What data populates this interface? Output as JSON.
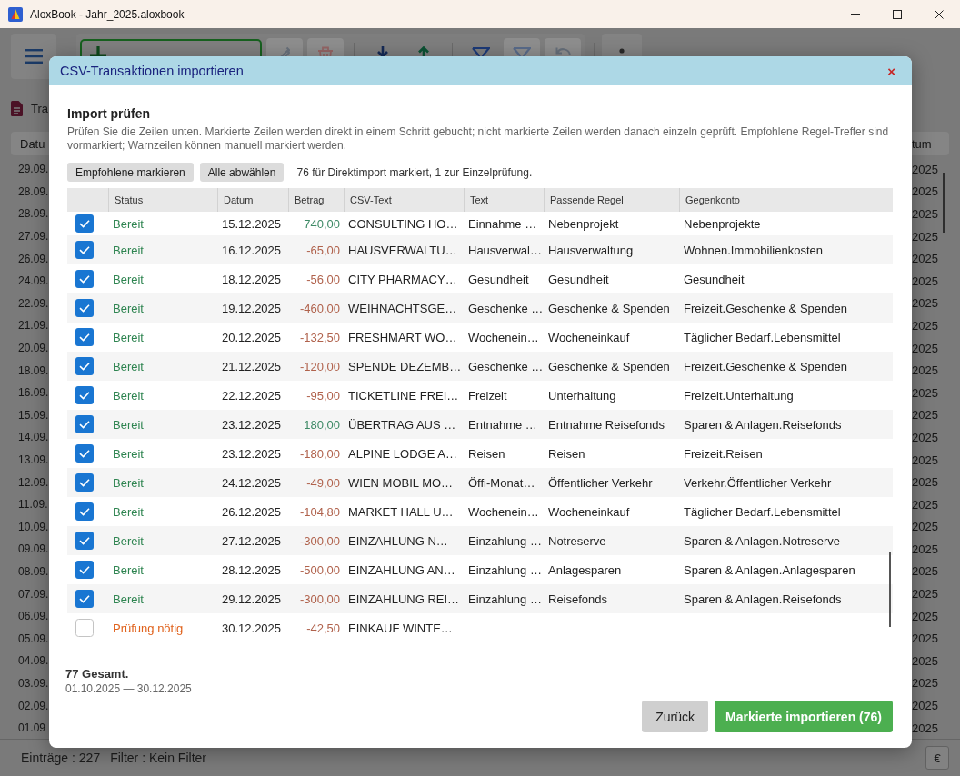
{
  "window": {
    "title": "AloxBook - Jahr_2025.aloxbook"
  },
  "toolbar": {
    "tools": [
      {
        "kind": "edit",
        "disabled": true
      },
      {
        "kind": "delete",
        "disabled": true
      },
      {
        "kind": "import",
        "disabled": false
      },
      {
        "kind": "export",
        "disabled": false
      },
      {
        "kind": "filter",
        "disabled": false
      },
      {
        "kind": "clear-filter",
        "disabled": true
      },
      {
        "kind": "undo",
        "disabled": true
      }
    ]
  },
  "tab": {
    "label": "Tra"
  },
  "background_table": {
    "columns": [
      "Datu",
      "tum"
    ],
    "rows": [
      [
        "29.09.",
        "2025"
      ],
      [
        "28.09.",
        "2025"
      ],
      [
        "28.09.",
        "2025"
      ],
      [
        "27.09.",
        "2025"
      ],
      [
        "26.09.",
        "2025"
      ],
      [
        "24.09.",
        "2025"
      ],
      [
        "22.09.",
        "2025"
      ],
      [
        "21.09.",
        "2025"
      ],
      [
        "20.09.",
        "2025"
      ],
      [
        "18.09.",
        "2025"
      ],
      [
        "16.09.",
        "2025"
      ],
      [
        "15.09.",
        "2025"
      ],
      [
        "14.09.",
        "2025"
      ],
      [
        "13.09.",
        "2025"
      ],
      [
        "12.09.",
        "2025"
      ],
      [
        "11.09.",
        "2025"
      ],
      [
        "10.09.",
        "2025"
      ],
      [
        "09.09.",
        "2025"
      ],
      [
        "08.09.",
        "2025"
      ],
      [
        "07.09.",
        "2025"
      ],
      [
        "06.09.",
        "2025"
      ],
      [
        "05.09.",
        "2025"
      ],
      [
        "04.09.",
        "2025"
      ],
      [
        "03.09.",
        "2025"
      ],
      [
        "02.09.",
        "2025"
      ],
      [
        "01.09",
        "2025"
      ]
    ]
  },
  "dialog": {
    "title": "CSV-Transaktionen importieren",
    "close": "×",
    "heading": "Import prüfen",
    "description": "Prüfen Sie die Zeilen unten. Markierte Zeilen werden direkt in einem Schritt gebucht; nicht markierte Zeilen werden danach einzeln geprüft. Empfohlene Regel-Treffer sind vormarkiert; Warnzeilen können manuell markiert werden.",
    "actions": [
      "Empfohlene markieren",
      "Alle abwählen"
    ],
    "selection_summary": "76 für Direktimport markiert, 1 zur Einzelprüfung.",
    "table": {
      "columns": [
        "Status",
        "Datum",
        "Betrag",
        "CSV-Text",
        "Text",
        "Passende Regel",
        "Gegenkonto"
      ],
      "rows": [
        {
          "checked": true,
          "status": {
            "label": "Bereit",
            "color": "#2e8450"
          },
          "date": "15.12.2025",
          "amount": {
            "value": "740,00",
            "color": "#3e8a66"
          },
          "csv_text": "CONSULTING HO…",
          "text": "Einnahme …",
          "rule": "Nebenprojekt",
          "account": "Nebenprojekte"
        },
        {
          "checked": true,
          "status": {
            "label": "Bereit",
            "color": "#2e8450"
          },
          "date": "16.12.2025",
          "amount": {
            "value": "-65,00",
            "color": "#b0624c"
          },
          "csv_text": "HAUSVERWALTU…",
          "text": "Hausverwal…",
          "rule": "Hausverwaltung",
          "account": "Wohnen.Immobilienkosten"
        },
        {
          "checked": true,
          "status": {
            "label": "Bereit",
            "color": "#2e8450"
          },
          "date": "18.12.2025",
          "amount": {
            "value": "-56,00",
            "color": "#b0624c"
          },
          "csv_text": "CITY PHARMACY…",
          "text": "Gesundheit",
          "rule": "Gesundheit",
          "account": "Gesundheit"
        },
        {
          "checked": true,
          "status": {
            "label": "Bereit",
            "color": "#2e8450"
          },
          "date": "19.12.2025",
          "amount": {
            "value": "-460,00",
            "color": "#b0624c"
          },
          "csv_text": "WEIHNACHTSGE…",
          "text": "Geschenke …",
          "rule": "Geschenke & Spenden",
          "account": "Freizeit.Geschenke & Spenden"
        },
        {
          "checked": true,
          "status": {
            "label": "Bereit",
            "color": "#2e8450"
          },
          "date": "20.12.2025",
          "amount": {
            "value": "-132,50",
            "color": "#b0624c"
          },
          "csv_text": "FRESHMART WO…",
          "text": "Wochenein…",
          "rule": "Wocheneinkauf",
          "account": "Täglicher Bedarf.Lebensmittel"
        },
        {
          "checked": true,
          "status": {
            "label": "Bereit",
            "color": "#2e8450"
          },
          "date": "21.12.2025",
          "amount": {
            "value": "-120,00",
            "color": "#b0624c"
          },
          "csv_text": "SPENDE DEZEMB…",
          "text": "Geschenke …",
          "rule": "Geschenke & Spenden",
          "account": "Freizeit.Geschenke & Spenden"
        },
        {
          "checked": true,
          "status": {
            "label": "Bereit",
            "color": "#2e8450"
          },
          "date": "22.12.2025",
          "amount": {
            "value": "-95,00",
            "color": "#b0624c"
          },
          "csv_text": "TICKETLINE FREI…",
          "text": "Freizeit",
          "rule": "Unterhaltung",
          "account": "Freizeit.Unterhaltung"
        },
        {
          "checked": true,
          "status": {
            "label": "Bereit",
            "color": "#2e8450"
          },
          "date": "23.12.2025",
          "amount": {
            "value": "180,00",
            "color": "#3e8a66"
          },
          "csv_text": "ÜBERTRAG AUS …",
          "text": "Entnahme …",
          "rule": "Entnahme Reisefonds",
          "account": "Sparen & Anlagen.Reisefonds"
        },
        {
          "checked": true,
          "status": {
            "label": "Bereit",
            "color": "#2e8450"
          },
          "date": "23.12.2025",
          "amount": {
            "value": "-180,00",
            "color": "#b0624c"
          },
          "csv_text": "ALPINE LODGE A…",
          "text": "Reisen",
          "rule": "Reisen",
          "account": "Freizeit.Reisen"
        },
        {
          "checked": true,
          "status": {
            "label": "Bereit",
            "color": "#2e8450"
          },
          "date": "24.12.2025",
          "amount": {
            "value": "-49,00",
            "color": "#b0624c"
          },
          "csv_text": "WIEN MOBIL MO…",
          "text": "Öffi-Monat…",
          "rule": "Öffentlicher Verkehr",
          "account": "Verkehr.Öffentlicher Verkehr"
        },
        {
          "checked": true,
          "status": {
            "label": "Bereit",
            "color": "#2e8450"
          },
          "date": "26.12.2025",
          "amount": {
            "value": "-104,80",
            "color": "#b0624c"
          },
          "csv_text": "MARKET HALL U…",
          "text": "Wochenein…",
          "rule": "Wocheneinkauf",
          "account": "Täglicher Bedarf.Lebensmittel"
        },
        {
          "checked": true,
          "status": {
            "label": "Bereit",
            "color": "#2e8450"
          },
          "date": "27.12.2025",
          "amount": {
            "value": "-300,00",
            "color": "#b0624c"
          },
          "csv_text": "EINZAHLUNG N…",
          "text": "Einzahlung …",
          "rule": "Notreserve",
          "account": "Sparen & Anlagen.Notreserve"
        },
        {
          "checked": true,
          "status": {
            "label": "Bereit",
            "color": "#2e8450"
          },
          "date": "28.12.2025",
          "amount": {
            "value": "-500,00",
            "color": "#b0624c"
          },
          "csv_text": "EINZAHLUNG AN…",
          "text": "Einzahlung …",
          "rule": "Anlagesparen",
          "account": "Sparen & Anlagen.Anlagesparen"
        },
        {
          "checked": true,
          "status": {
            "label": "Bereit",
            "color": "#2e8450"
          },
          "date": "29.12.2025",
          "amount": {
            "value": "-300,00",
            "color": "#b0624c"
          },
          "csv_text": "EINZAHLUNG REI…",
          "text": "Einzahlung …",
          "rule": "Reisefonds",
          "account": "Sparen & Anlagen.Reisefonds"
        },
        {
          "checked": false,
          "status": {
            "label": "Prüfung nötig",
            "color": "#e0621c"
          },
          "date": "30.12.2025",
          "amount": {
            "value": "-42,50",
            "color": "#b0624c"
          },
          "csv_text": "EINKAUF WINTE…"
        }
      ]
    },
    "total": "77 Gesamt.",
    "date_range": "01.10.2025 — 30.12.2025",
    "buttons": [
      {
        "label": "Zurück",
        "kind": "secondary"
      },
      {
        "label": "Markierte importieren (76)",
        "kind": "primary"
      }
    ]
  },
  "status_bar": {
    "entries": "Einträge : 227",
    "filter": "Filter : Kein Filter",
    "currency_button": "€"
  }
}
